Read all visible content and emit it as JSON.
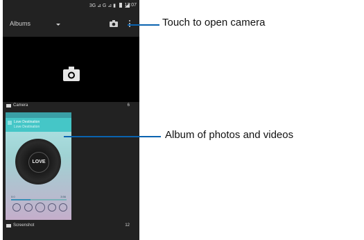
{
  "status_bar": {
    "signal_text": "3G ⊿ G ⊿ ▮",
    "time": "12:07"
  },
  "action_bar": {
    "spinner_label": "Albums"
  },
  "albums": [
    {
      "name": "Camera",
      "count": "6"
    },
    {
      "name": "Screenshot",
      "count": "12"
    }
  ],
  "screenshot_preview": {
    "app_title": "Love Destination",
    "app_subtitle": "Love Destination",
    "record_label": "LOVE",
    "time_start": "0:0",
    "time_end": "3:56",
    "progress_fraction": 0.35
  },
  "annotations": {
    "camera_callout": "Touch to open camera",
    "album_callout": "Album of photos and videos"
  },
  "colors": {
    "callout_line": "#0a63b0",
    "phone_bg": "#222222",
    "accent_teal": "#45c6c7"
  }
}
